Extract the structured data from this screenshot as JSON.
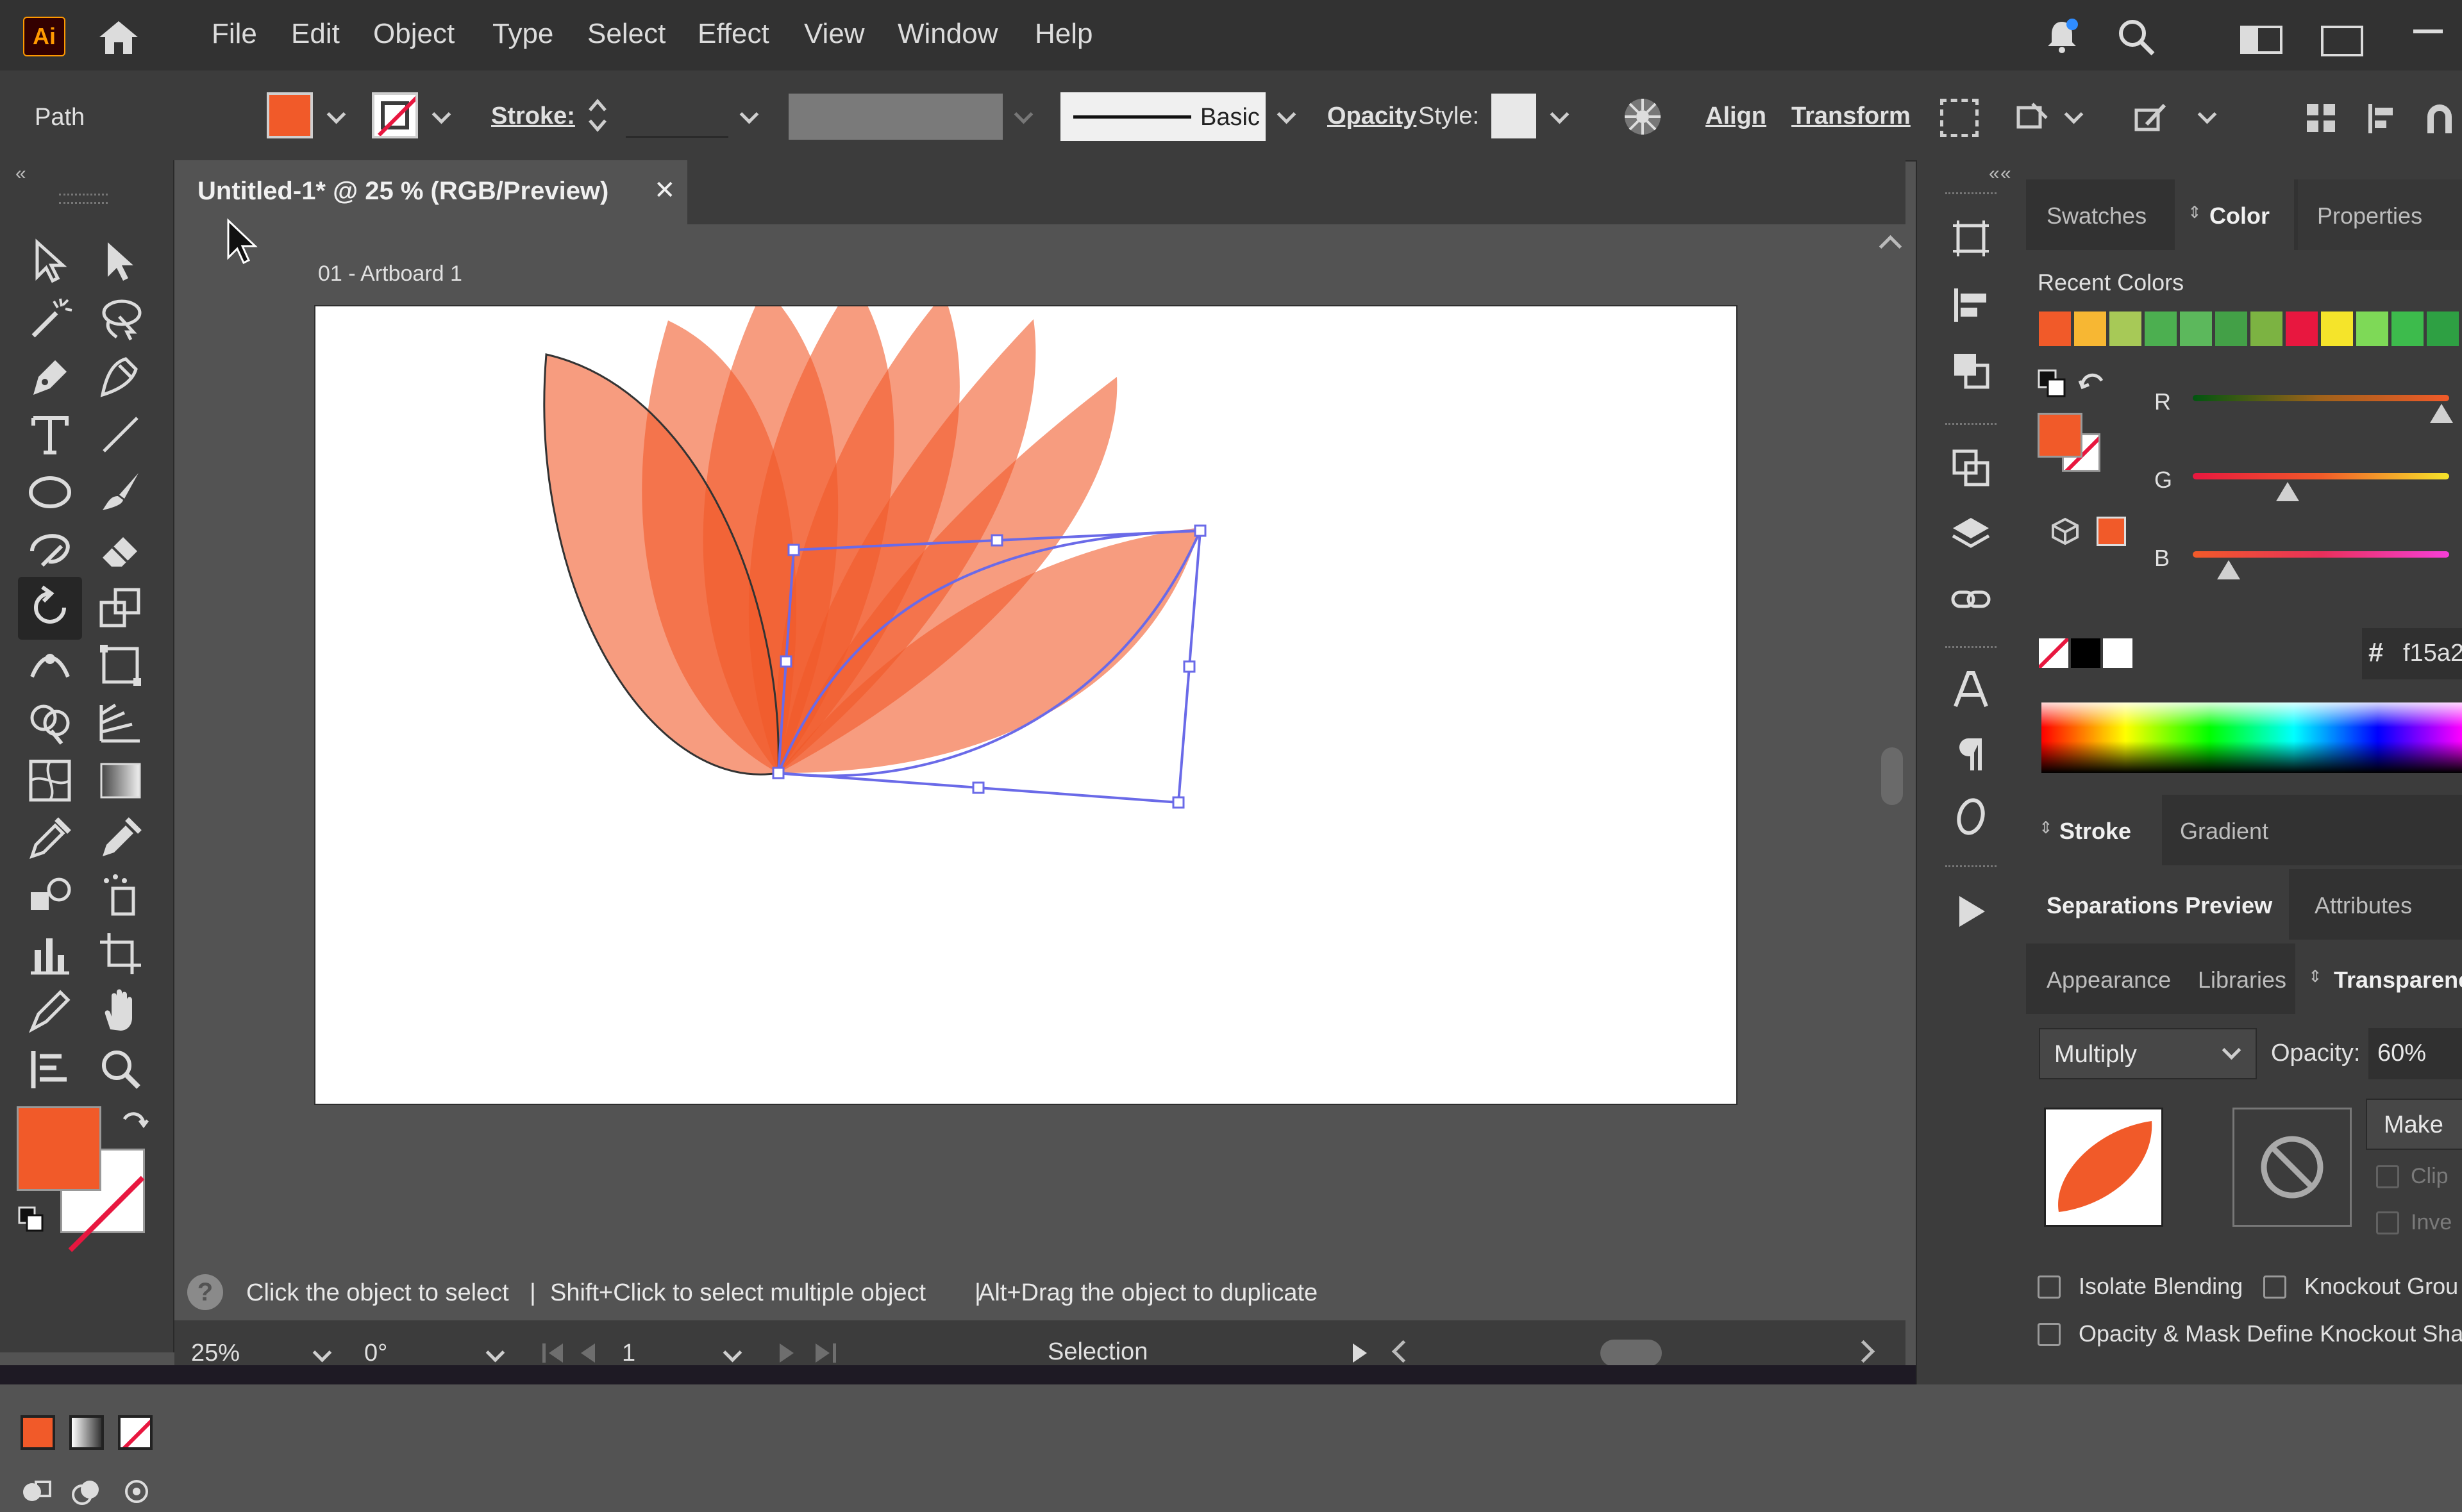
{
  "menubar": {
    "app_logo": "Ai",
    "items": [
      "File",
      "Edit",
      "Object",
      "Type",
      "Select",
      "Effect",
      "View",
      "Window",
      "Help"
    ]
  },
  "control": {
    "selection_type": "Path",
    "stroke_label": "Stroke:",
    "brush_label": "Basic",
    "opacity_label": "Opacity",
    "style_label": "Style:",
    "align_label": "Align",
    "transform_label": "Transform"
  },
  "document": {
    "tab_title": "Untitled-1* @ 25 % (RGB/Preview)",
    "close_symbol": "✕",
    "artboard_label": "01 - Artboard 1"
  },
  "status": {
    "hint_icon": "?",
    "hint_1": "Click the object to select",
    "hint_sep": "|",
    "hint_2": "Shift+Click to select multiple object",
    "hint_3": "Alt+Drag the object to duplicate"
  },
  "bottom": {
    "zoom": "25%",
    "rotation": "0°",
    "artboard_number": "1",
    "tool_name": "Selection"
  },
  "panel": {
    "tabs_top": [
      "Swatches",
      "Color",
      "Properties"
    ],
    "recent_colors_label": "Recent Colors",
    "recent_colors": [
      "#f15a29",
      "#f7b733",
      "#a7c957",
      "#4caf50",
      "#5cb85c",
      "#43a047",
      "#7cb342",
      "#e8173f",
      "#f5e42a",
      "#7ed957",
      "#3dbb4c",
      "#2ea043"
    ],
    "channels": [
      "R",
      "G",
      "B"
    ],
    "channel_levels": [
      0.97,
      0.37,
      0.14
    ],
    "hex_symbol": "#",
    "hex_value": "f15a2",
    "fill_color": "#f15a29",
    "tabs_mid": [
      "Stroke",
      "Gradient"
    ],
    "tabs_sep": [
      "Separations Preview",
      "Attributes"
    ],
    "tabs_bottom": [
      "Appearance",
      "Libraries",
      "Transparenc"
    ],
    "blend_mode": "Multiply",
    "opacity_label": "Opacity:",
    "opacity_value": "60%",
    "make_mask": "Make",
    "clip_label": "Clip",
    "invert_label": "Inve",
    "isolate_blending": "Isolate Blending",
    "knockout_group": "Knockout Grou",
    "opacity_mask": "Opacity & Mask Define Knockout Sha"
  },
  "icons": {
    "home": "home-icon",
    "bell": "bell-icon",
    "search": "search-icon"
  }
}
